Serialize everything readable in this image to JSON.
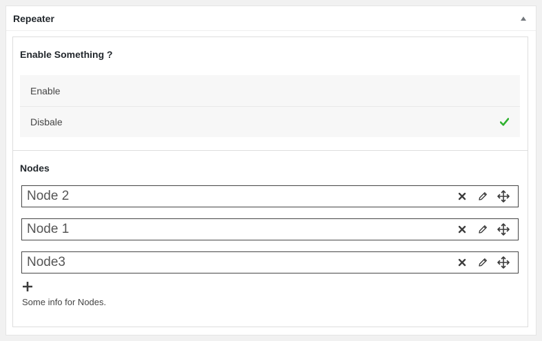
{
  "metabox": {
    "title": "Repeater"
  },
  "enable_field": {
    "label": "Enable Something ?",
    "options": [
      {
        "label": "Enable",
        "selected": false
      },
      {
        "label": "Disbale",
        "selected": true
      }
    ],
    "check_color": "#2fb12f"
  },
  "nodes_field": {
    "label": "Nodes",
    "items": [
      {
        "label": "Node 2"
      },
      {
        "label": "Node 1"
      },
      {
        "label": "Node3"
      }
    ],
    "info": "Some info for Nodes."
  }
}
